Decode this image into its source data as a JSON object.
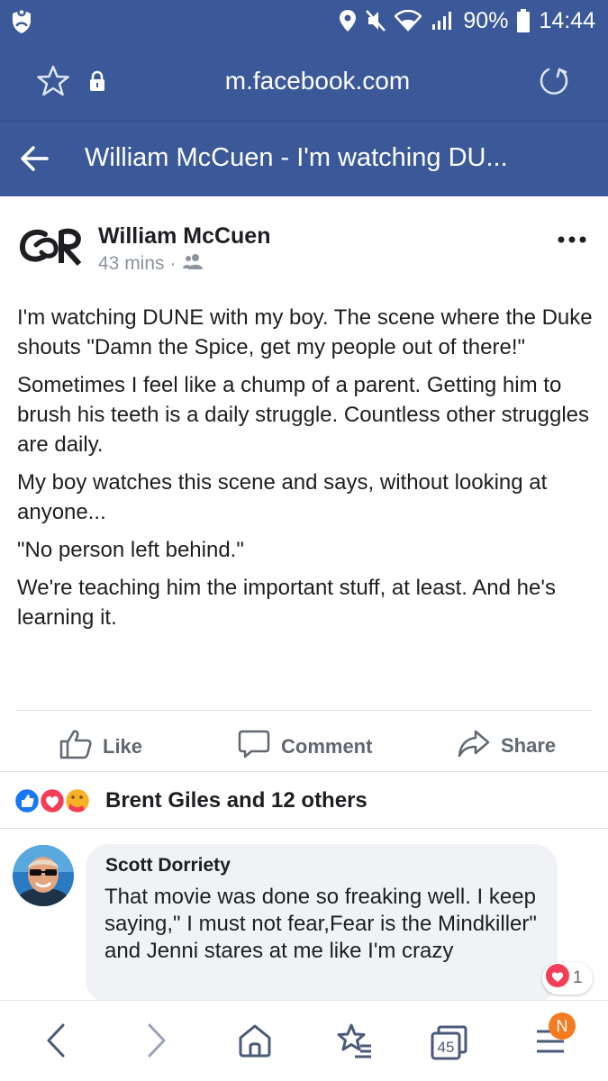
{
  "status_bar": {
    "battery": "90%",
    "time": "14:44",
    "icons": [
      "shield-icon",
      "location-icon",
      "mute-icon",
      "wifi-icon",
      "signal-icon",
      "battery-icon"
    ]
  },
  "url_bar": {
    "url": "m.facebook.com",
    "icons": [
      "star-icon",
      "lock-icon",
      "reload-icon"
    ]
  },
  "title_bar": {
    "title": "William McCuen - I'm watching DU..."
  },
  "post": {
    "author": "William McCuen",
    "time": "43 mins",
    "separator": "·",
    "audience_icon": "friends-icon",
    "paragraphs": [
      "I'm watching DUNE with my boy. The scene where the Duke shouts \"Damn the Spice, get my people out of there!\"",
      "Sometimes I feel like a chump of a parent. Getting him to brush his teeth is a daily struggle. Countless other struggles are daily.",
      "My boy watches this scene and says, without looking at anyone...",
      "\"No person left behind.\"",
      "We're teaching him the important stuff, at least. And he's learning it."
    ],
    "actions": {
      "like": "Like",
      "comment": "Comment",
      "share": "Share"
    },
    "reactions_text": "Brent Giles and 12 others"
  },
  "comment": {
    "author": "Scott Dorriety",
    "text": "That movie was done so freaking well. I keep saying,\" I must not fear,Fear is the Mindkiller\" and Jenni stares at me like I'm crazy",
    "reaction_count": "1"
  },
  "bottom_nav": {
    "tabs_count": "45",
    "badge": "N"
  },
  "colors": {
    "brand": "#3b5998",
    "like_blue": "#1877f2",
    "love_red": "#f33e58",
    "badge_orange": "#f47b20"
  }
}
